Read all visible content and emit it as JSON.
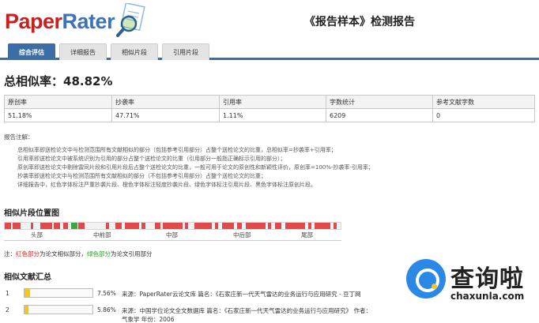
{
  "header": {
    "logo_part1": "Paper",
    "logo_part2": "Rater",
    "report_title": "《报告样本》检测报告"
  },
  "tabs": [
    {
      "label": "综合评估",
      "active": true
    },
    {
      "label": "详细报告",
      "active": false
    },
    {
      "label": "相似片段",
      "active": false
    },
    {
      "label": "引用片段",
      "active": false
    }
  ],
  "summary": {
    "total_similarity": "总相似率：48.82%"
  },
  "stats_table": {
    "headers": [
      "原创率",
      "抄袭率",
      "引用率",
      "字数统计",
      "参考文献字数"
    ],
    "values": [
      "51.18%",
      "47.71%",
      "1.11%",
      "6209",
      "0"
    ]
  },
  "notes": {
    "title": "报告注解：",
    "items": [
      "总相似率即送检论文中与检测范围所有文献相似的部分（包括参考引用部分）占整个送检论文的比重，总相似率=抄袭率+引用率；",
      "引用率即送检论文中被系统识别为引用的部分占整个送检论文的比重（引用部分一般指正确标示引用的部分）；",
      "原创率即送检论文中剔除雷同片段和引用片段后占整个送检论文的比重，一般可用于论文的原创性和新颖性评价，原创率=100%-抄袭率-引用率；",
      "抄袭率即送检论文中与检测范围所有文献相似的部分（不包括参考引用部分）占整个送检论文的比重；",
      "详细报告中，红色字体标注严重抄袭片段、橙色字体标注轻度抄袭片段、绿色字体标注引用片段、黑色字体标注原创片段。"
    ]
  },
  "position": {
    "title": "相似片段位置图",
    "labels": [
      "头部",
      "中前部",
      "中部",
      "中后部",
      "尾部"
    ]
  },
  "legend_note": {
    "prefix": "注：",
    "red_text": "红色部分",
    "red_desc": "为论文相似部分，",
    "green_text": "绿色部分",
    "green_desc": "为论文引用部分"
  },
  "references": {
    "title": "相似文献汇总",
    "rows": [
      {
        "index": "1",
        "percent": "7.56%",
        "fill": 0.076,
        "source": "来源：PaperRater云论文库  篇名：《石家庄新一代天气雷达的业务运行与应用研究 - 豆丁网",
        "source2": ""
      },
      {
        "index": "2",
        "percent": "5.86%",
        "fill": 0.059,
        "source": "来源：中国学位论文全文数据库  篇名：《石家庄新一代天气雷达的业务运行与应用研究》 作者：",
        "source2": "气象学 年份：2006"
      }
    ]
  },
  "watermark": {
    "cn": "查询啦",
    "en": "chaxunla.com"
  },
  "colors": {
    "accent": "#3b6ea5",
    "similar_red": "#e04a4a",
    "cite_green": "#3da63d",
    "bar_yellow": "#f5c518"
  }
}
